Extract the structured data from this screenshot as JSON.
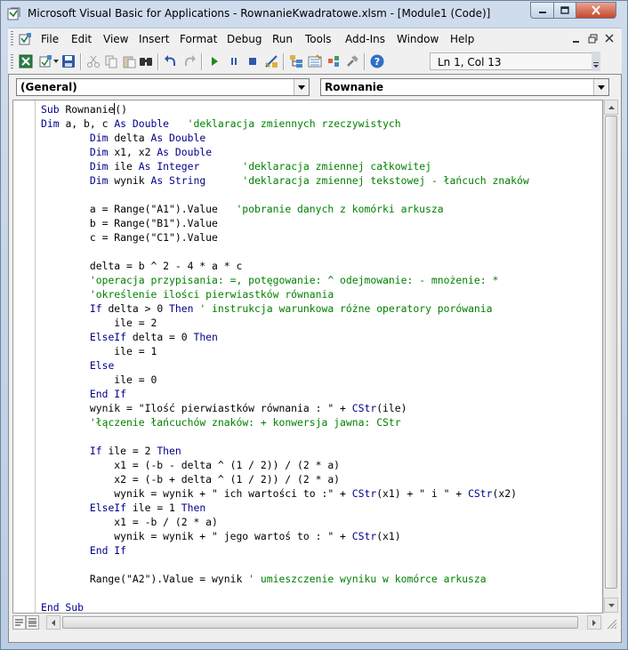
{
  "window": {
    "title": "Microsoft Visual Basic for Applications - RownanieKwadratowe.xlsm - [Module1 (Code)]"
  },
  "menu": {
    "items": [
      "File",
      "Edit",
      "View",
      "Insert",
      "Format",
      "Debug",
      "Run",
      "Tools",
      "Add-Ins",
      "Window",
      "Help"
    ]
  },
  "toolbar": {
    "position": "Ln 1, Col 13",
    "icons": [
      "excel-icon",
      "insert-module-icon",
      "save-icon",
      "cut-icon",
      "copy-icon",
      "paste-icon",
      "find-icon",
      "undo-icon",
      "redo-icon",
      "run-icon",
      "break-icon",
      "reset-icon",
      "design-mode-icon",
      "project-explorer-icon",
      "properties-icon",
      "object-browser-icon",
      "toolbox-icon",
      "help-icon"
    ]
  },
  "code_pane": {
    "object_combo": "(General)",
    "procedure_combo": "Rownanie"
  },
  "code": {
    "lines": [
      [
        {
          "t": "Sub ",
          "c": "kw"
        },
        {
          "t": "Rownanie"
        },
        {
          "t": "|",
          "c": "caret"
        },
        {
          "t": "()"
        }
      ],
      [
        {
          "t": "Dim ",
          "c": "kw"
        },
        {
          "t": "a, b, c "
        },
        {
          "t": "As Double",
          "c": "kw"
        },
        {
          "t": "   "
        },
        {
          "t": "'deklaracja zmiennych rzeczywistych",
          "c": "cm"
        }
      ],
      [
        {
          "t": "        "
        },
        {
          "t": "Dim ",
          "c": "kw"
        },
        {
          "t": "delta "
        },
        {
          "t": "As Double",
          "c": "kw"
        }
      ],
      [
        {
          "t": "        "
        },
        {
          "t": "Dim ",
          "c": "kw"
        },
        {
          "t": "x1, x2 "
        },
        {
          "t": "As Double",
          "c": "kw"
        }
      ],
      [
        {
          "t": "        "
        },
        {
          "t": "Dim ",
          "c": "kw"
        },
        {
          "t": "ile "
        },
        {
          "t": "As Integer",
          "c": "kw"
        },
        {
          "t": "       "
        },
        {
          "t": "'deklaracja zmiennej całkowitej",
          "c": "cm"
        }
      ],
      [
        {
          "t": "        "
        },
        {
          "t": "Dim ",
          "c": "kw"
        },
        {
          "t": "wynik "
        },
        {
          "t": "As String",
          "c": "kw"
        },
        {
          "t": "      "
        },
        {
          "t": "'deklaracja zmiennej tekstowej - łańcuch znaków",
          "c": "cm"
        }
      ],
      [
        {
          "t": ""
        }
      ],
      [
        {
          "t": "        a = Range(\"A1\").Value   "
        },
        {
          "t": "'pobranie danych z komórki arkusza",
          "c": "cm"
        }
      ],
      [
        {
          "t": "        b = Range(\"B1\").Value"
        }
      ],
      [
        {
          "t": "        c = Range(\"C1\").Value"
        }
      ],
      [
        {
          "t": ""
        }
      ],
      [
        {
          "t": "        delta = b ^ 2 - 4 * a * c"
        }
      ],
      [
        {
          "t": "        "
        },
        {
          "t": "'operacja przypisania: =, potęgowanie: ^ odejmowanie: - mnożenie: *",
          "c": "cm"
        }
      ],
      [
        {
          "t": "        "
        },
        {
          "t": "'określenie ilości pierwiastków równania",
          "c": "cm"
        }
      ],
      [
        {
          "t": "        "
        },
        {
          "t": "If ",
          "c": "kw"
        },
        {
          "t": "delta > 0 "
        },
        {
          "t": "Then",
          "c": "kw"
        },
        {
          "t": " "
        },
        {
          "t": "' instrukcja warunkowa różne operatory porówania",
          "c": "cm"
        }
      ],
      [
        {
          "t": "            ile = 2"
        }
      ],
      [
        {
          "t": "        "
        },
        {
          "t": "ElseIf ",
          "c": "kw"
        },
        {
          "t": "delta = 0 "
        },
        {
          "t": "Then",
          "c": "kw"
        }
      ],
      [
        {
          "t": "            ile = 1"
        }
      ],
      [
        {
          "t": "        "
        },
        {
          "t": "Else",
          "c": "kw"
        }
      ],
      [
        {
          "t": "            ile = 0"
        }
      ],
      [
        {
          "t": "        "
        },
        {
          "t": "End If",
          "c": "kw"
        }
      ],
      [
        {
          "t": "        wynik = \"Ilość pierwiastków równania : \" + "
        },
        {
          "t": "CStr",
          "c": "kw"
        },
        {
          "t": "(ile)"
        }
      ],
      [
        {
          "t": "        "
        },
        {
          "t": "'łączenie łańcuchów znaków: + konwersja jawna: CStr",
          "c": "cm"
        }
      ],
      [
        {
          "t": ""
        }
      ],
      [
        {
          "t": "        "
        },
        {
          "t": "If ",
          "c": "kw"
        },
        {
          "t": "ile = 2 "
        },
        {
          "t": "Then",
          "c": "kw"
        }
      ],
      [
        {
          "t": "            x1 = (-b - delta ^ (1 / 2)) / (2 * a)"
        }
      ],
      [
        {
          "t": "            x2 = (-b + delta ^ (1 / 2)) / (2 * a)"
        }
      ],
      [
        {
          "t": "            wynik = wynik + \" ich wartości to :\" + "
        },
        {
          "t": "CStr",
          "c": "kw"
        },
        {
          "t": "(x1) + \" i \" + "
        },
        {
          "t": "CStr",
          "c": "kw"
        },
        {
          "t": "(x2)"
        }
      ],
      [
        {
          "t": "        "
        },
        {
          "t": "ElseIf ",
          "c": "kw"
        },
        {
          "t": "ile = 1 "
        },
        {
          "t": "Then",
          "c": "kw"
        }
      ],
      [
        {
          "t": "            x1 = -b / (2 * a)"
        }
      ],
      [
        {
          "t": "            wynik = wynik + \" jego wartoś to : \" + "
        },
        {
          "t": "CStr",
          "c": "kw"
        },
        {
          "t": "(x1)"
        }
      ],
      [
        {
          "t": "        "
        },
        {
          "t": "End If",
          "c": "kw"
        }
      ],
      [
        {
          "t": ""
        }
      ],
      [
        {
          "t": "        Range(\"A2\").Value = wynik "
        },
        {
          "t": "' umieszczenie wyniku w komórce arkusza",
          "c": "cm"
        }
      ],
      [
        {
          "t": ""
        }
      ],
      [
        {
          "t": "End Sub",
          "c": "kw"
        }
      ]
    ]
  }
}
